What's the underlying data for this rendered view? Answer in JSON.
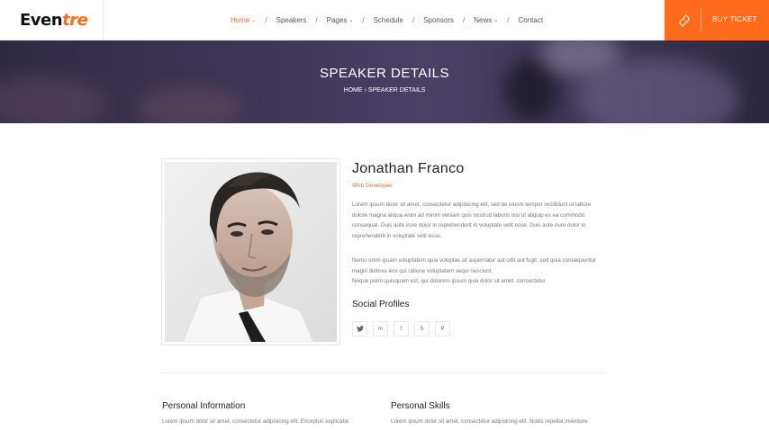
{
  "brand": {
    "logo_main": "Even",
    "logo_accent": "tre"
  },
  "nav": {
    "items": [
      {
        "label": "Home",
        "dropdown": true,
        "active": true
      },
      {
        "label": "Speakers",
        "dropdown": false,
        "active": false
      },
      {
        "label": "Pages",
        "dropdown": true,
        "active": false
      },
      {
        "label": "Schedule",
        "dropdown": false,
        "active": false
      },
      {
        "label": "Sponsors",
        "dropdown": false,
        "active": false
      },
      {
        "label": "News",
        "dropdown": true,
        "active": false
      },
      {
        "label": "Contact",
        "dropdown": false,
        "active": false
      }
    ],
    "separator": "/",
    "caret": "⌄",
    "buy_ticket": "BUY TICKET"
  },
  "banner": {
    "title": "SPEAKER DETAILS",
    "breadcrumb": [
      "HOME",
      "SPEAKER DETAILS"
    ],
    "breadcrumb_sep": "›"
  },
  "speaker": {
    "name": "Jonathan Franco",
    "role": "Web Developer",
    "bio_1": "Lorem ipsum dolor sit amet, consectetur adipisicing elit, sed do eiusm tempor incididunt ut labore dolore magna aliqua enim ad minim veniam quis nostrud laboris nisi ut aliquip ex ea commodo consequat. Duis aute irure dolor in reprehenderit in voluptate velit esse. Duis aute irure dolor in reprehenderit in voluptate velit esse.",
    "bio_2": "Nemo enim ipsam voluptatem quia voluptas sit aspernatur aut odit aut fugit, sed quia consequuntur magni dolores eos qui ratione voluptatem sequi nesciunt.",
    "bio_3": "Neque porro quisquam est, qui dolorem ipsum quia dolor sit amet, consectetur",
    "social_title": "Social Profiles",
    "socials": [
      {
        "icon": "twitter-icon",
        "glyph": "𝕥"
      },
      {
        "icon": "linkedin-icon",
        "glyph": "in"
      },
      {
        "icon": "facebook-icon",
        "glyph": "f"
      },
      {
        "icon": "skype-icon",
        "glyph": "S"
      },
      {
        "icon": "pinterest-icon",
        "glyph": "P"
      }
    ]
  },
  "sections": {
    "personal_info_title": "Personal Information",
    "personal_info_text": "Lorem ipsum dolor sit amet, consectetur adipisicing elit. Excepturi explicabo",
    "personal_skills_title": "Personal Skills",
    "personal_skills_text": "Lorem ipsum dolor sit amet, consectetur adipisicing elit. Nobis repellat inventore"
  },
  "colors": {
    "accent": "#ff6b1a",
    "banner": "#3e3658"
  }
}
